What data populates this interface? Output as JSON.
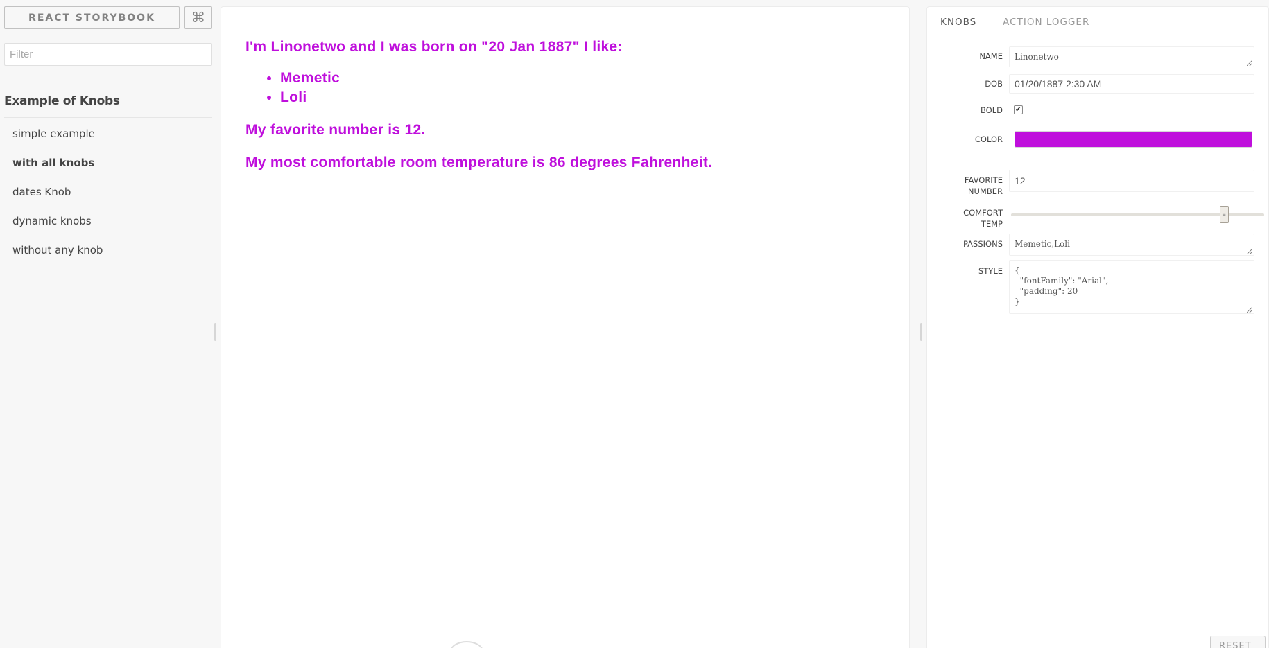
{
  "sidebar": {
    "brand": "REACT STORYBOOK",
    "shortcut_icon": "⌘",
    "filter_placeholder": "Filter",
    "kind_title": "Example of Knobs",
    "stories": [
      "simple example",
      "with all knobs",
      "dates Knob",
      "dynamic knobs",
      "without any knob"
    ],
    "active_story": "with all knobs"
  },
  "preview": {
    "intro": "I'm Linonetwo and I was born on \"20 Jan 1887\" I like:",
    "passions": [
      "Memetic",
      "Loli"
    ],
    "favorite": "My favorite number is 12.",
    "temperature": "My most comfortable room temperature is 86 degrees Fahrenheit.",
    "text_color": "#bf0fdc"
  },
  "panel": {
    "tabs": [
      "KNOBS",
      "ACTION LOGGER"
    ],
    "active_tab": "KNOBS",
    "knobs": {
      "name": {
        "label": "NAME",
        "value": "Linonetwo"
      },
      "dob": {
        "label": "DOB",
        "value": "01/20/1887 2:30 AM"
      },
      "bold": {
        "label": "BOLD",
        "checked": true
      },
      "color": {
        "label": "COLOR",
        "value": "#bf0fdc"
      },
      "favorite_number": {
        "label_line1": "FAVORITE",
        "label_line2": "NUMBER",
        "value": "12"
      },
      "comfort_temp": {
        "label_line1": "COMFORT",
        "label_line2": "TEMP",
        "value_fraction": 0.84
      },
      "passions": {
        "label": "PASSIONS",
        "value": "Memetic,Loli"
      },
      "style": {
        "label": "STYLE",
        "value": "{\n  \"fontFamily\": \"Arial\",\n  \"padding\": 20\n}"
      }
    },
    "reset_label": "RESET"
  }
}
